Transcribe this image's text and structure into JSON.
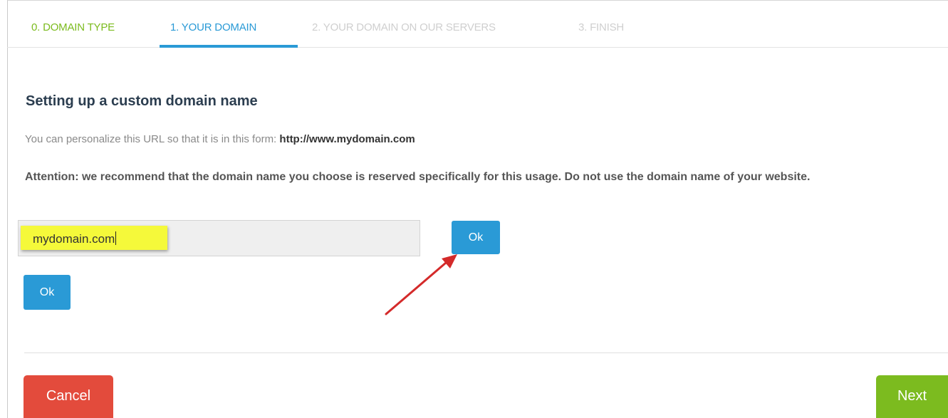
{
  "steps": [
    {
      "label": "0. DOMAIN TYPE",
      "state": "done"
    },
    {
      "label": "1. YOUR DOMAIN",
      "state": "active"
    },
    {
      "label": "2. YOUR DOMAIN ON OUR SERVERS",
      "state": "todo"
    },
    {
      "label": "3. FINISH",
      "state": "todo"
    }
  ],
  "main": {
    "heading": "Setting up a custom domain name",
    "description_prefix": "You can personalize this URL so that it is in this form: ",
    "description_url": "http://www.mydomain.com",
    "attention": "Attention: we recommend that the domain name you choose is reserved specifically for this usage. Do not use the domain name of your website.",
    "domain_input_value": "mydomain.com",
    "ok_inline_label": "Ok",
    "ok_below_label": "Ok"
  },
  "footer": {
    "cancel_label": "Cancel",
    "next_label": "Next"
  },
  "colors": {
    "step_done": "#7cbb1f",
    "step_active": "#2a9ad6",
    "step_todo": "#cfcfcf",
    "ok_button": "#2a9ad6",
    "cancel_button": "#e34b3c",
    "next_button": "#7cbb1f",
    "highlight": "#f5f93a",
    "annotation_arrow": "#d42a2a"
  }
}
